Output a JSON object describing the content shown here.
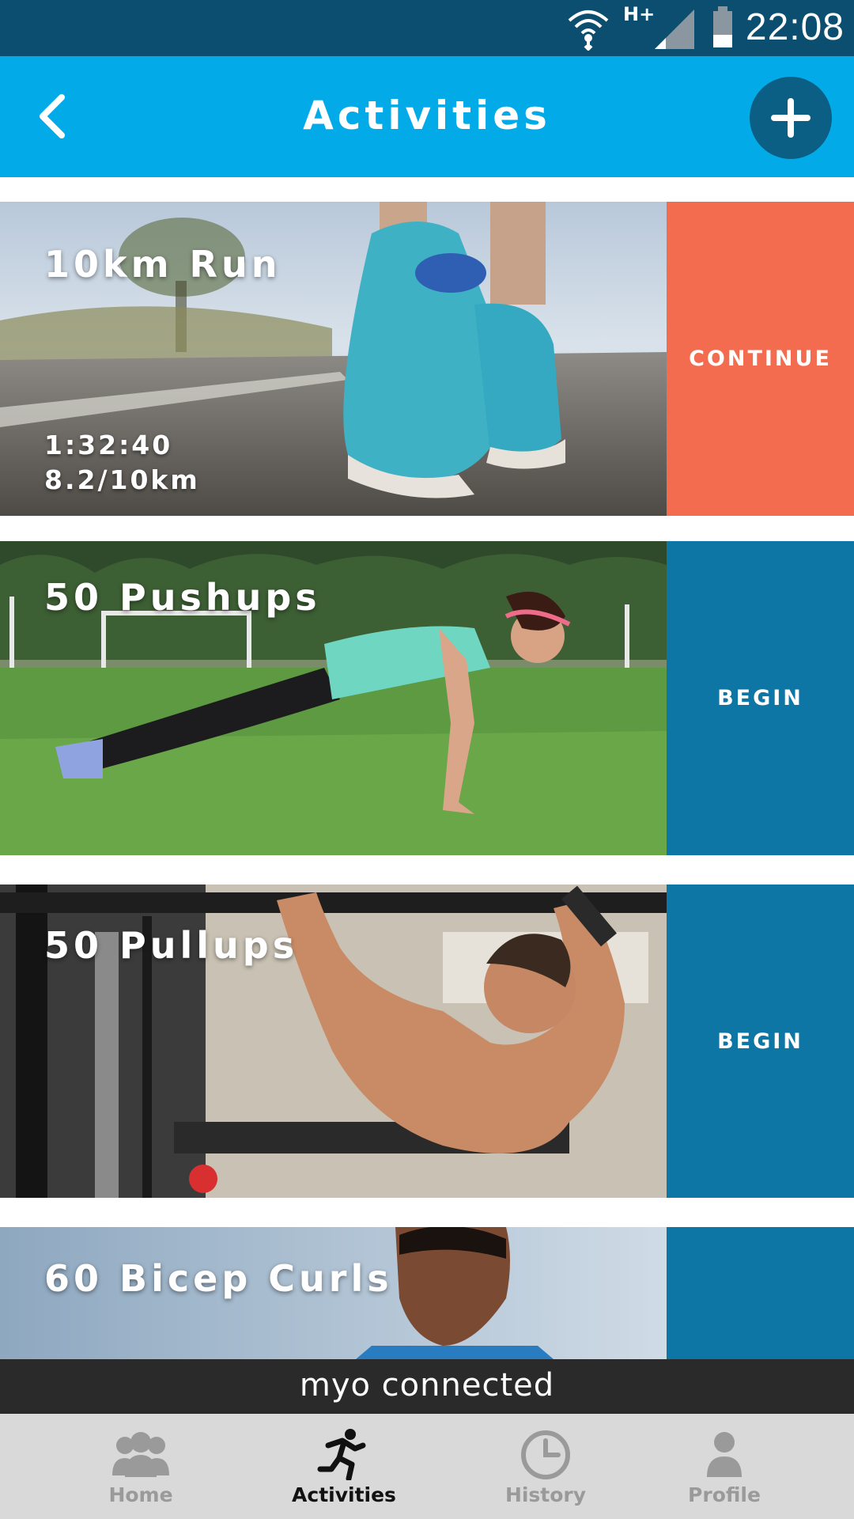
{
  "status_bar": {
    "time": "22:08",
    "network_type": "H+"
  },
  "header": {
    "title": "Activities"
  },
  "activities": [
    {
      "title": "10km Run",
      "time": "1:32:40",
      "progress": "8.2/10km",
      "action": "CONTINUE"
    },
    {
      "title": "50 Pushups",
      "action": "BEGIN"
    },
    {
      "title": "50 Pullups",
      "action": "BEGIN"
    },
    {
      "title": "60 Bicep Curls"
    }
  ],
  "toast": {
    "text": "myo connected"
  },
  "bottom_nav": {
    "items": [
      {
        "label": "Home",
        "icon": "group-icon"
      },
      {
        "label": "Activities",
        "icon": "running-icon",
        "active": true
      },
      {
        "label": "History",
        "icon": "clock-icon"
      },
      {
        "label": "Profile",
        "icon": "person-icon"
      }
    ]
  },
  "colors": {
    "status_bar": "#0b4e6f",
    "header": "#03aae8",
    "continue": "#f36c4f",
    "begin": "#0e76a5",
    "nav_bg": "#d9d9d9"
  }
}
